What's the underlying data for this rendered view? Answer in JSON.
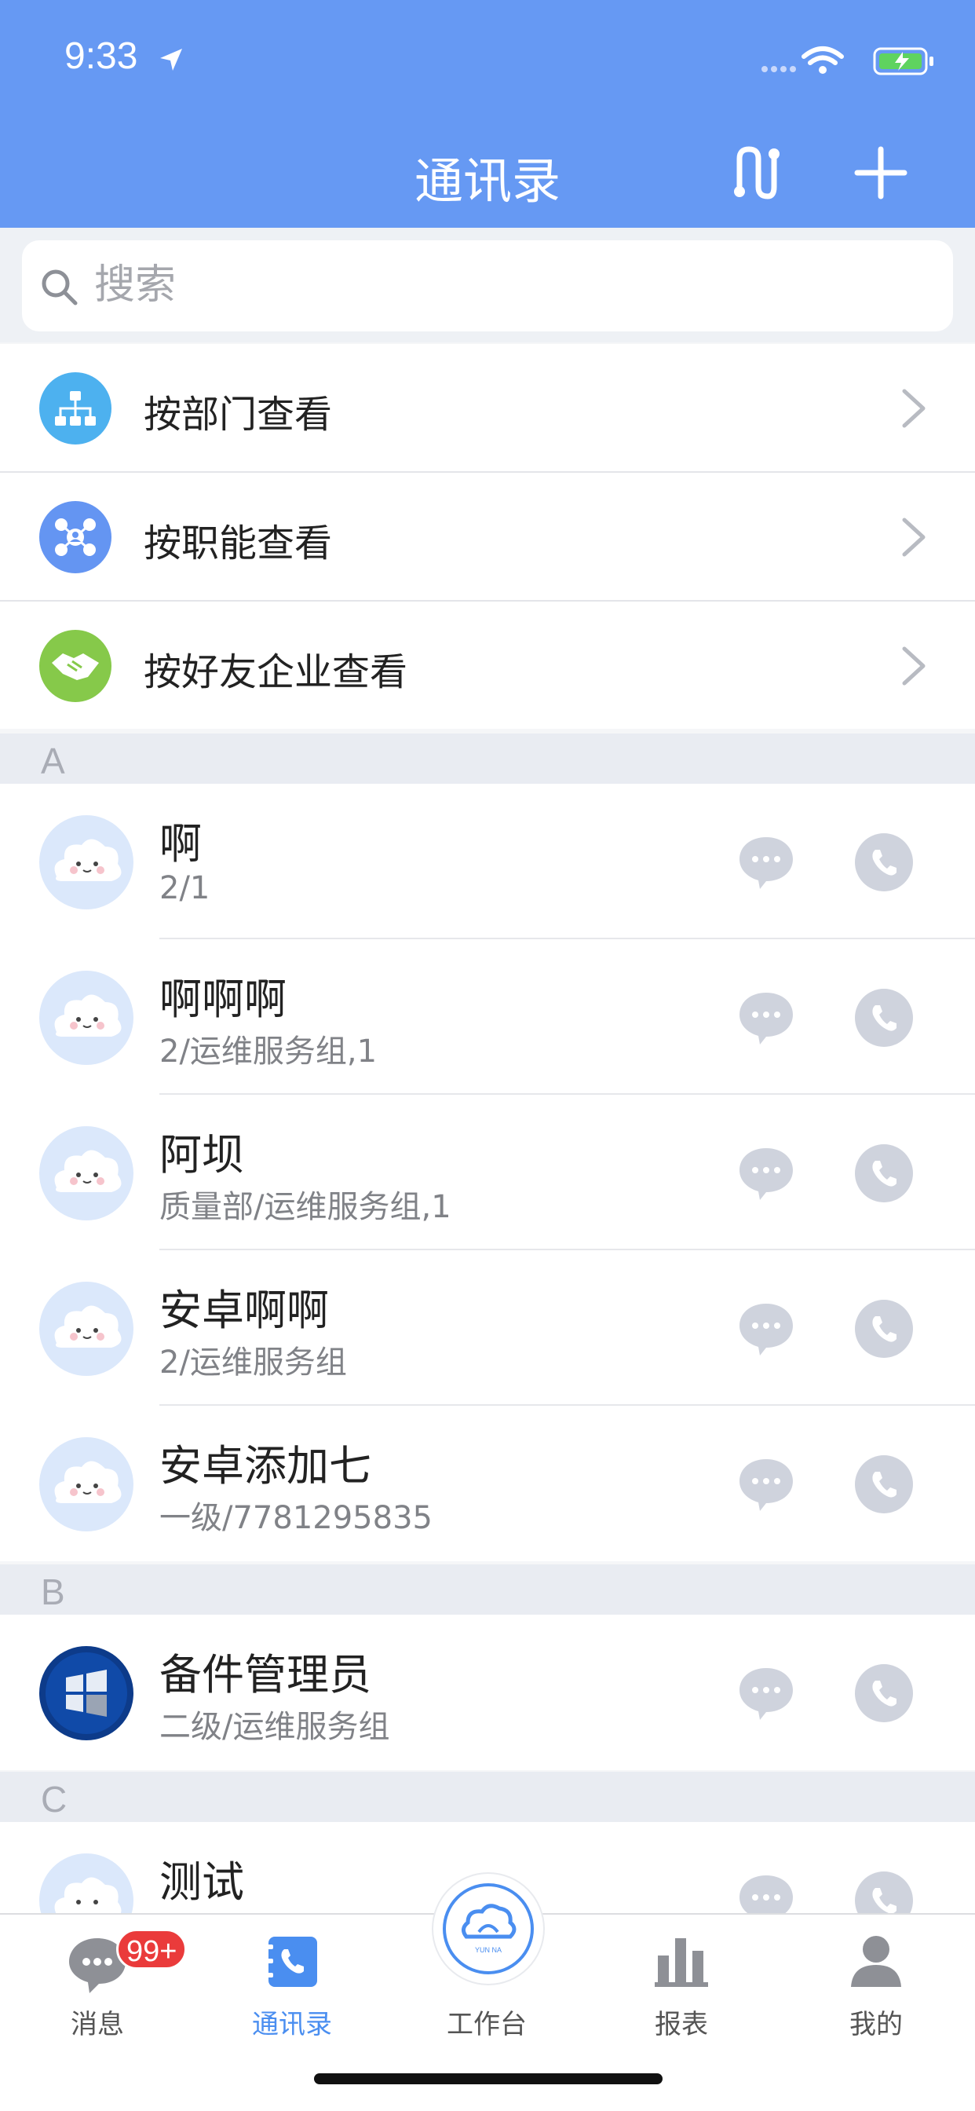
{
  "status": {
    "time": "9:33"
  },
  "header": {
    "title": "通讯录"
  },
  "search": {
    "placeholder": "搜索"
  },
  "menu": [
    {
      "label": "按部门查看",
      "icon": "org-chart-icon",
      "color": "#4db1ef"
    },
    {
      "label": "按职能查看",
      "icon": "function-network-icon",
      "color": "#6495f2"
    },
    {
      "label": "按好友企业查看",
      "icon": "handshake-icon",
      "color": "#86c94a"
    }
  ],
  "sections": [
    {
      "letter": "A",
      "contacts": [
        {
          "name": "啊",
          "sub": "2/1",
          "avatar": "cloud-avatar"
        },
        {
          "name": "啊啊啊",
          "sub": "2/运维服务组,1",
          "avatar": "cloud-avatar"
        },
        {
          "name": "阿坝",
          "sub": "质量部/运维服务组,1",
          "avatar": "cloud-avatar"
        },
        {
          "name": "安卓啊啊",
          "sub": "2/运维服务组",
          "avatar": "cloud-avatar"
        },
        {
          "name": "安卓添加七",
          "sub": "一级/7781295835",
          "avatar": "cloud-avatar"
        }
      ]
    },
    {
      "letter": "B",
      "contacts": [
        {
          "name": "备件管理员",
          "sub": "二级/运维服务组",
          "avatar": "windows-avatar"
        }
      ]
    },
    {
      "letter": "C",
      "contacts": [
        {
          "name": "测试",
          "sub": "",
          "avatar": "cloud-avatar"
        }
      ]
    }
  ],
  "tabbar": {
    "tabs": [
      {
        "label": "消息",
        "icon": "chat-bubble-icon",
        "badge": "99+"
      },
      {
        "label": "通讯录",
        "icon": "contacts-book-icon",
        "active": true
      },
      {
        "label": "工作台",
        "icon": "cloud-logo-icon",
        "logo_text": "YUN NA"
      },
      {
        "label": "报表",
        "icon": "bar-chart-icon"
      },
      {
        "label": "我的",
        "icon": "person-icon"
      }
    ]
  },
  "colors": {
    "primary": "#6699f3",
    "active_tab": "#4a8ef0",
    "badge": "#ea3b3b",
    "action_icon": "#cfd3dd"
  }
}
